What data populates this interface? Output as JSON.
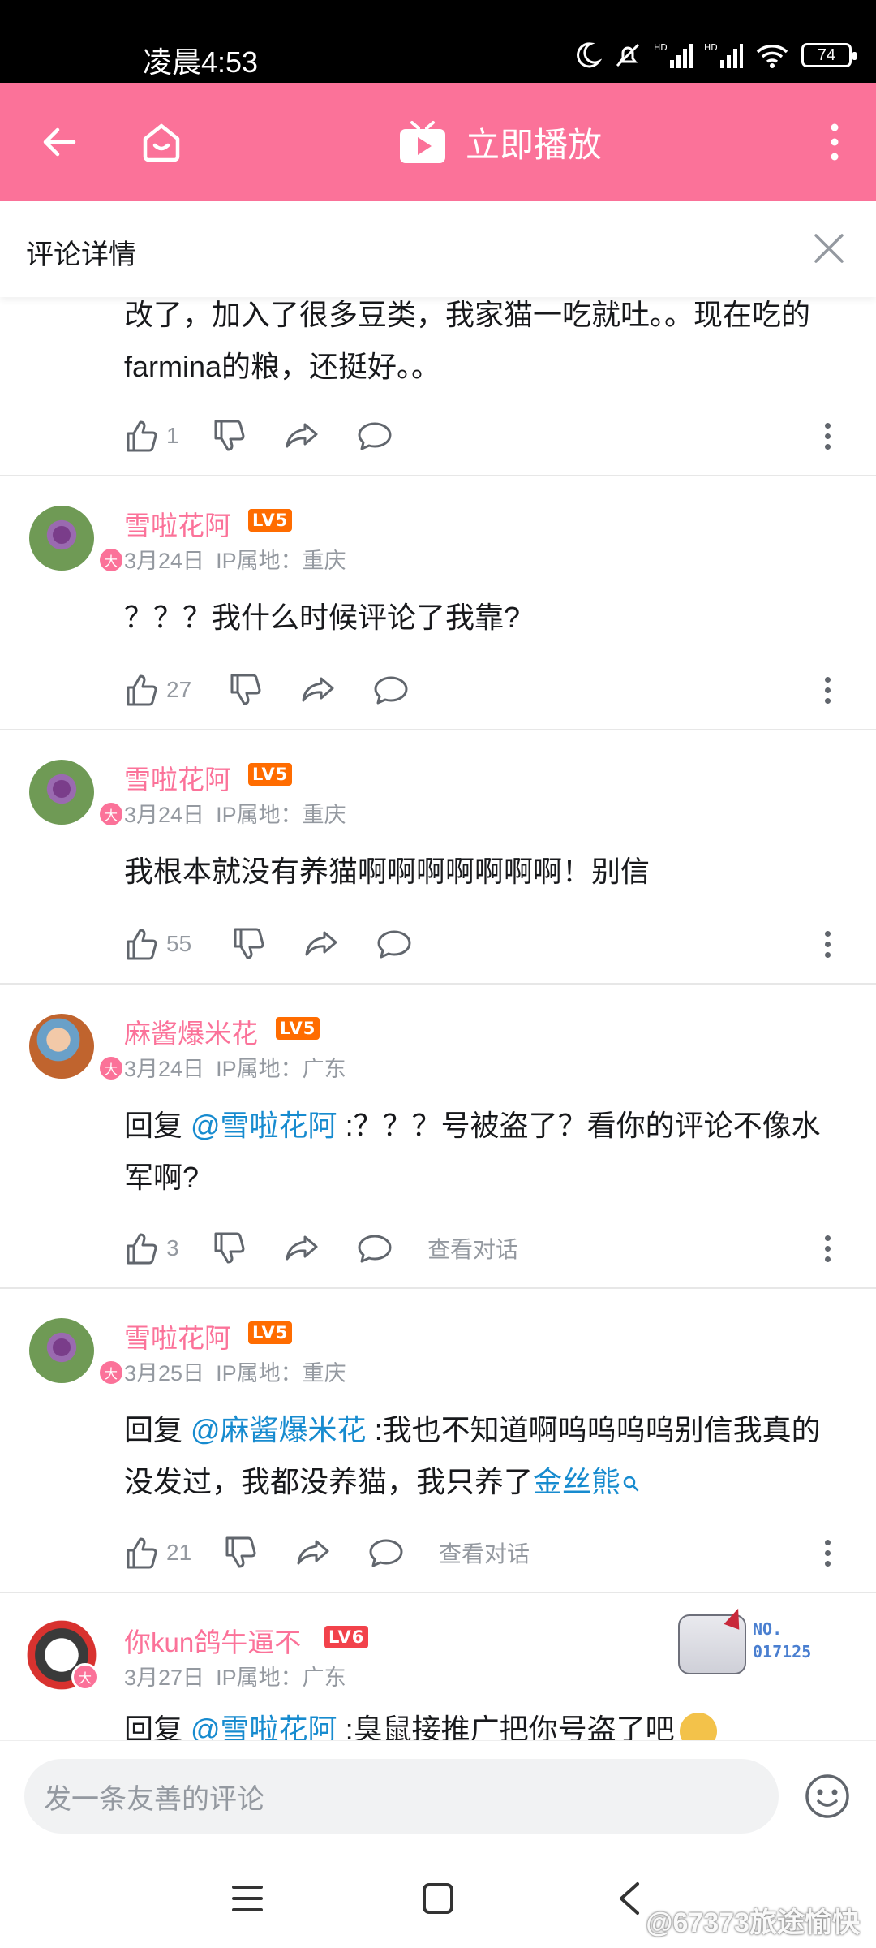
{
  "status_bar": {
    "time": "凌晨4:53",
    "battery": "74",
    "icons": [
      "moon-icon",
      "bell-muted-icon",
      "hd-signal-icon",
      "hd-signal-icon",
      "wifi-icon",
      "battery-icon"
    ]
  },
  "top_bar": {
    "back_icon": "arrow-left-icon",
    "home_icon": "home-icon",
    "play_label": "立即播放",
    "more_icon": "more-vertical-icon",
    "accent_color": "#fb7299"
  },
  "subheader": {
    "title": "评论详情",
    "close_icon": "close-icon"
  },
  "comments": [
    {
      "text": "改了，加入了很多豆类，我家猫一吃就吐。。现在吃的farmina的粮，还挺好。。",
      "likes": "1"
    },
    {
      "user": "雪啦花阿",
      "level": "LV5",
      "date": "3月24日",
      "ip": "IP属地：重庆",
      "text": "？？？我什么时候评论了我靠?",
      "likes": "27"
    },
    {
      "user": "雪啦花阿",
      "level": "LV5",
      "date": "3月24日",
      "ip": "IP属地：重庆",
      "text": "我根本就没有养猫啊啊啊啊啊啊啊！别信",
      "likes": "55"
    },
    {
      "user": "麻酱爆米花",
      "level": "LV5",
      "date": "3月24日",
      "ip": "IP属地：广东",
      "reply_prefix": "回复 ",
      "mention": "@雪啦花阿",
      "text": " :？？？号被盗了？看你的评论不像水军啊?",
      "likes": "3",
      "view_dialog": "查看对话"
    },
    {
      "user": "雪啦花阿",
      "level": "LV5",
      "date": "3月25日",
      "ip": "IP属地：重庆",
      "reply_prefix": "回复 ",
      "mention": "@麻酱爆米花",
      "text": " :我也不知道啊呜呜呜呜别信我真的没发过，我都没养猫，我只养了",
      "link": "金丝熊",
      "likes": "21",
      "view_dialog": "查看对话"
    },
    {
      "user": "你kun鸽牛逼不",
      "level": "LV6",
      "date": "3月27日",
      "ip": "IP属地：广东",
      "reply_prefix": "回复 ",
      "mention": "@雪啦花阿",
      "text": " :臭鼠接推广把你号盗了吧",
      "fan_badge_label": "NO.",
      "fan_badge_number": "017125"
    }
  ],
  "avatar_badge": "大",
  "bottom": {
    "input_placeholder": "发一条友善的评论",
    "emoji_icon": "emoji-icon",
    "nav_icons": [
      "menu-icon",
      "square-home-icon",
      "back-chevron-icon"
    ]
  },
  "watermark": "@67373旅途愉快"
}
